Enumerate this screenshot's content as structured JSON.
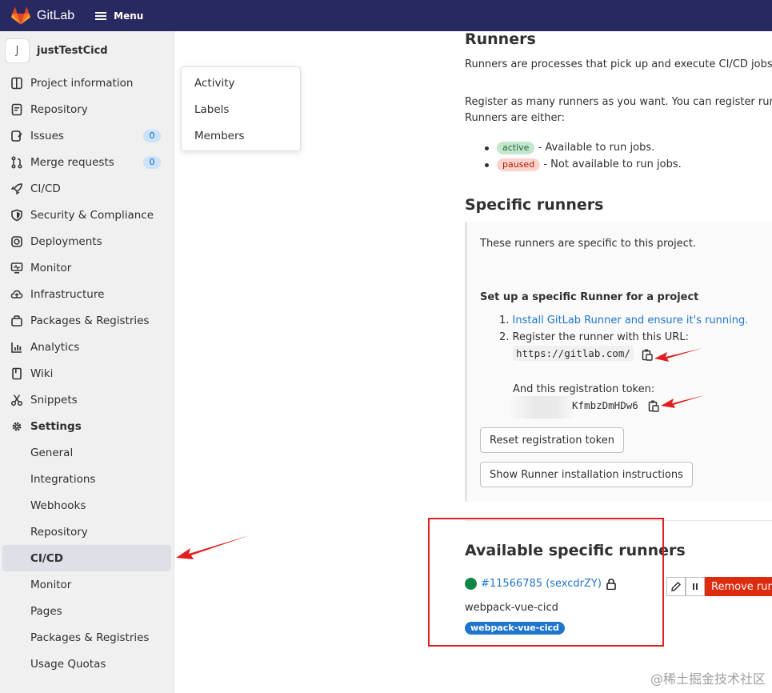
{
  "app": {
    "name": "GitLab",
    "menu_label": "Menu"
  },
  "project": {
    "avatar_letter": "J",
    "name": "justTestCicd"
  },
  "sidebar": {
    "items": [
      {
        "label": "Project information",
        "icon": "info-icon"
      },
      {
        "label": "Repository",
        "icon": "doc-icon"
      },
      {
        "label": "Issues",
        "icon": "issues-icon",
        "badge": "0"
      },
      {
        "label": "Merge requests",
        "icon": "merge-icon",
        "badge": "0"
      },
      {
        "label": "CI/CD",
        "icon": "rocket-icon"
      },
      {
        "label": "Security & Compliance",
        "icon": "shield-icon"
      },
      {
        "label": "Deployments",
        "icon": "deploy-icon"
      },
      {
        "label": "Monitor",
        "icon": "monitor-icon"
      },
      {
        "label": "Infrastructure",
        "icon": "cloud-icon"
      },
      {
        "label": "Packages & Registries",
        "icon": "package-icon"
      },
      {
        "label": "Analytics",
        "icon": "chart-icon"
      },
      {
        "label": "Wiki",
        "icon": "book-icon"
      },
      {
        "label": "Snippets",
        "icon": "scissors-icon"
      },
      {
        "label": "Settings",
        "icon": "gear-icon"
      }
    ],
    "settings_sub": [
      "General",
      "Integrations",
      "Webhooks",
      "Repository",
      "CI/CD",
      "Monitor",
      "Pages",
      "Packages & Registries",
      "Usage Quotas"
    ]
  },
  "dropdown": {
    "items": [
      "Activity",
      "Labels",
      "Members"
    ]
  },
  "runners": {
    "title": "Runners",
    "intro": "Runners are processes that pick up and execute CI/CD jobs for",
    "register_line1": "Register as many runners as you want. You can register runners",
    "register_line2": "Runners are either:",
    "active_pill": "active",
    "active_desc": "- Available to run jobs.",
    "paused_pill": "paused",
    "paused_desc": "- Not available to run jobs."
  },
  "specific": {
    "title": "Specific runners",
    "desc": "These runners are specific to this project.",
    "setup_title": "Set up a specific Runner for a project",
    "step1_num": "1.",
    "step1_link": "Install GitLab Runner and ensure it's running.",
    "step2_num": "2.",
    "step2": "Register the runner with this URL:",
    "url": "https://gitlab.com/",
    "token_label": "And this registration token:",
    "token": "KfmbzDmHDw6",
    "reset_btn": "Reset registration token",
    "show_btn": "Show Runner installation instructions"
  },
  "available": {
    "title": "Available specific runners",
    "runner_id": "#11566785 (sexcdrZY)",
    "runner_name": "webpack-vue-cicd",
    "tag": "webpack-vue-cicd",
    "remove_btn": "Remove runne"
  },
  "watermark": "@稀土掘金技术社区",
  "colors": {
    "topbar": "#292961",
    "link": "#1f75cb",
    "danger": "#dd2b0e",
    "annotation": "#e02020",
    "online": "#108548"
  }
}
